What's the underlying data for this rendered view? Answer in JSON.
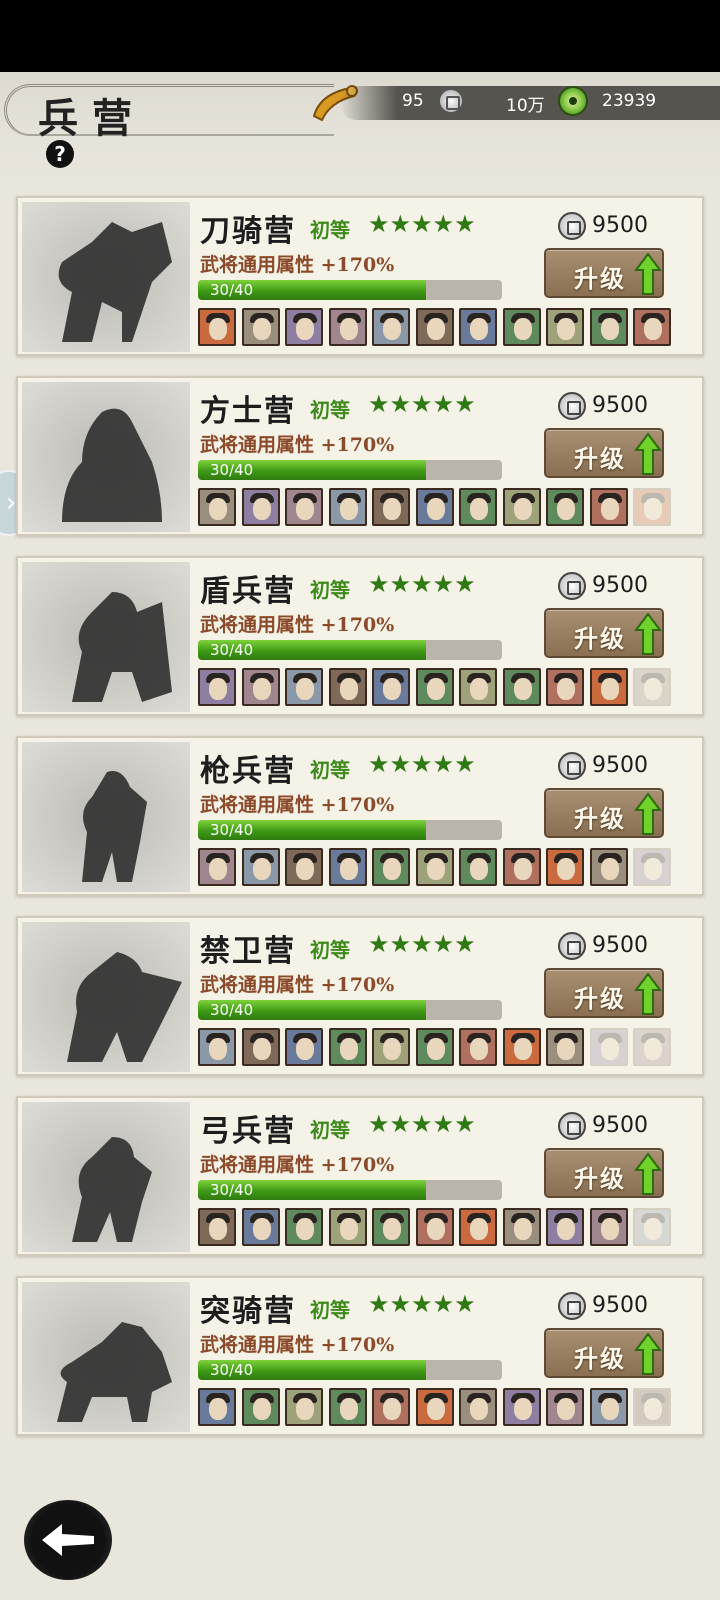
{
  "header": {
    "title": "兵营",
    "help_label": "?",
    "resources": {
      "horn_count": "95",
      "silver": "10万",
      "jade": "23939"
    }
  },
  "camps": [
    {
      "name": "刀骑营",
      "grade": "初等",
      "stars": "★★★★★",
      "attribute": "武将通用属性 +170%",
      "progress_text": "30/40",
      "progress": 0.75,
      "cost": "9500",
      "button": "升级",
      "avatar_count": 11,
      "unlocked_count": 11
    },
    {
      "name": "方士营",
      "grade": "初等",
      "stars": "★★★★★",
      "attribute": "武将通用属性 +170%",
      "progress_text": "30/40",
      "progress": 0.75,
      "cost": "9500",
      "button": "升级",
      "avatar_count": 11,
      "unlocked_count": 10
    },
    {
      "name": "盾兵营",
      "grade": "初等",
      "stars": "★★★★★",
      "attribute": "武将通用属性 +170%",
      "progress_text": "30/40",
      "progress": 0.75,
      "cost": "9500",
      "button": "升级",
      "avatar_count": 11,
      "unlocked_count": 10
    },
    {
      "name": "枪兵营",
      "grade": "初等",
      "stars": "★★★★★",
      "attribute": "武将通用属性 +170%",
      "progress_text": "30/40",
      "progress": 0.75,
      "cost": "9500",
      "button": "升级",
      "avatar_count": 11,
      "unlocked_count": 10
    },
    {
      "name": "禁卫营",
      "grade": "初等",
      "stars": "★★★★★",
      "attribute": "武将通用属性 +170%",
      "progress_text": "30/40",
      "progress": 0.75,
      "cost": "9500",
      "button": "升级",
      "avatar_count": 11,
      "unlocked_count": 9
    },
    {
      "name": "弓兵营",
      "grade": "初等",
      "stars": "★★★★★",
      "attribute": "武将通用属性 +170%",
      "progress_text": "30/40",
      "progress": 0.75,
      "cost": "9500",
      "button": "升级",
      "avatar_count": 11,
      "unlocked_count": 10
    },
    {
      "name": "突骑营",
      "grade": "初等",
      "stars": "★★★★★",
      "attribute": "武将通用属性 +170%",
      "progress_text": "30/40",
      "progress": 0.75,
      "cost": "9500",
      "button": "升级",
      "avatar_count": 11,
      "unlocked_count": 10
    }
  ],
  "icons": {
    "help": "question-icon",
    "horn": "horn-icon",
    "silver": "silver-coin-icon",
    "jade": "jade-icon",
    "upgrade": "up-arrow-icon",
    "back": "back-arrow-icon",
    "side": "chevron-right-icon"
  },
  "colors": {
    "accent_green": "#3e8a1c",
    "attribute_brown": "#8b4a2a",
    "button_brown": "#8a6f52"
  }
}
